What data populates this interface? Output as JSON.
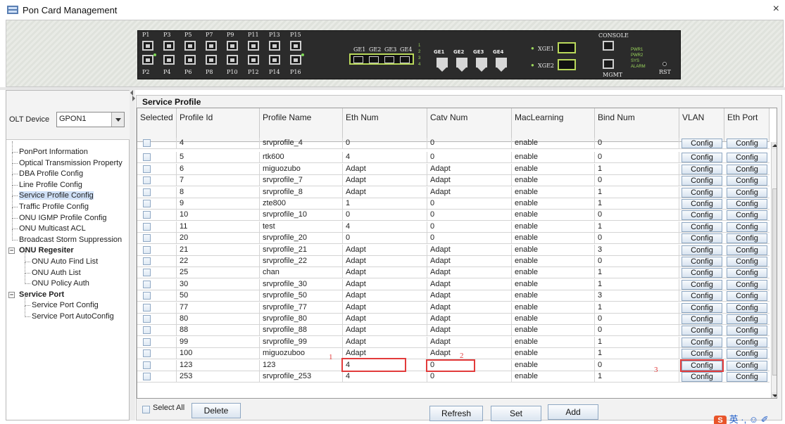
{
  "window": {
    "title": "Pon Card Management",
    "close_glyph": "×"
  },
  "device_panel": {
    "pon_ports_top": [
      "P1",
      "P3",
      "P5",
      "P7",
      "P9",
      "P11",
      "P13",
      "P15"
    ],
    "pon_ports_bottom": [
      "P2",
      "P4",
      "P6",
      "P8",
      "P10",
      "P12",
      "P14",
      "P16"
    ],
    "ge_labels": [
      "GE1",
      "GE2",
      "GE3",
      "GE4"
    ],
    "ge_leds": [
      "1",
      "2",
      "3",
      "4"
    ],
    "ge_opt_labels": [
      "GE1",
      "GE2",
      "GE3",
      "GE4"
    ],
    "xge_labels": [
      "XGE1",
      "XGE2"
    ],
    "console_label": "CONSOLE",
    "mgmt_label": "MGMT",
    "status_leds": [
      "PWR1",
      "PWR2",
      "SYS",
      "ALARM"
    ],
    "rst_label": "RST"
  },
  "left_panel": {
    "olt_label": "OLT Device",
    "olt_value": "GPON1",
    "tree": [
      {
        "label": "PonPort Information",
        "level": 1
      },
      {
        "label": "Optical Transmission Property",
        "level": 1
      },
      {
        "label": "DBA Profile Config",
        "level": 1
      },
      {
        "label": "Line Profile Config",
        "level": 1
      },
      {
        "label": "Service Profile Config",
        "level": 1,
        "selected": true
      },
      {
        "label": "Traffic Profile Config",
        "level": 1
      },
      {
        "label": "ONU IGMP Profile Config",
        "level": 1
      },
      {
        "label": "ONU Multicast ACL",
        "level": 1
      },
      {
        "label": "Broadcast Storm Suppression",
        "level": 1
      },
      {
        "label": "ONU Regesiter",
        "level": 0,
        "group": true
      },
      {
        "label": "ONU Auto Find List",
        "level": 2
      },
      {
        "label": "ONU Auth List",
        "level": 2
      },
      {
        "label": "ONU Policy Auth",
        "level": 2
      },
      {
        "label": "Service Port",
        "level": 0,
        "group": true
      },
      {
        "label": "Service Port Config",
        "level": 2
      },
      {
        "label": "Service Port AutoConfig",
        "level": 2
      }
    ]
  },
  "service_profile": {
    "section_title": "Service Profile",
    "columns": [
      "Selected",
      "Profile Id",
      "Profile Name",
      "Eth Num",
      "Catv Num",
      "MacLearning",
      "Bind Num",
      "VLAN",
      "Eth Port"
    ],
    "config_label": "Config",
    "rows": [
      {
        "id": "4",
        "name": "srvprofile_4",
        "eth": "0",
        "catv": "0",
        "mac": "enable",
        "bind": "0",
        "partial": true
      },
      {
        "id": "5",
        "name": "rtk600",
        "eth": "4",
        "catv": "0",
        "mac": "enable",
        "bind": "0"
      },
      {
        "id": "6",
        "name": "miguozubo",
        "eth": "Adapt",
        "catv": "Adapt",
        "mac": "enable",
        "bind": "1"
      },
      {
        "id": "7",
        "name": "srvprofile_7",
        "eth": "Adapt",
        "catv": "Adapt",
        "mac": "enable",
        "bind": "0"
      },
      {
        "id": "8",
        "name": "srvprofile_8",
        "eth": "Adapt",
        "catv": "Adapt",
        "mac": "enable",
        "bind": "1"
      },
      {
        "id": "9",
        "name": "zte800",
        "eth": "1",
        "catv": "0",
        "mac": "enable",
        "bind": "1"
      },
      {
        "id": "10",
        "name": "srvprofile_10",
        "eth": "0",
        "catv": "0",
        "mac": "enable",
        "bind": "0"
      },
      {
        "id": "11",
        "name": "test",
        "eth": "4",
        "catv": "0",
        "mac": "enable",
        "bind": "1"
      },
      {
        "id": "20",
        "name": "srvprofile_20",
        "eth": "0",
        "catv": "0",
        "mac": "enable",
        "bind": "0"
      },
      {
        "id": "21",
        "name": "srvprofile_21",
        "eth": "Adapt",
        "catv": "Adapt",
        "mac": "enable",
        "bind": "3"
      },
      {
        "id": "22",
        "name": "srvprofile_22",
        "eth": "Adapt",
        "catv": "Adapt",
        "mac": "enable",
        "bind": "0"
      },
      {
        "id": "25",
        "name": "chan",
        "eth": "Adapt",
        "catv": "Adapt",
        "mac": "enable",
        "bind": "1"
      },
      {
        "id": "30",
        "name": "srvprofile_30",
        "eth": "Adapt",
        "catv": "Adapt",
        "mac": "enable",
        "bind": "1"
      },
      {
        "id": "50",
        "name": "srvprofile_50",
        "eth": "Adapt",
        "catv": "Adapt",
        "mac": "enable",
        "bind": "3"
      },
      {
        "id": "77",
        "name": "srvprofile_77",
        "eth": "Adapt",
        "catv": "Adapt",
        "mac": "enable",
        "bind": "1"
      },
      {
        "id": "80",
        "name": "srvprofile_80",
        "eth": "Adapt",
        "catv": "Adapt",
        "mac": "enable",
        "bind": "0"
      },
      {
        "id": "88",
        "name": "srvprofile_88",
        "eth": "Adapt",
        "catv": "Adapt",
        "mac": "enable",
        "bind": "0"
      },
      {
        "id": "99",
        "name": "srvprofile_99",
        "eth": "Adapt",
        "catv": "Adapt",
        "mac": "enable",
        "bind": "1"
      },
      {
        "id": "100",
        "name": "miguozuboo",
        "eth": "Adapt",
        "catv": "Adapt",
        "mac": "enable",
        "bind": "1"
      },
      {
        "id": "123",
        "name": "123",
        "eth": "4",
        "catv": "0",
        "mac": "enable",
        "bind": "0",
        "editing": true
      },
      {
        "id": "253",
        "name": "srvprofile_253",
        "eth": "4",
        "catv": "0",
        "mac": "enable",
        "bind": "1"
      }
    ],
    "annotations": [
      "1",
      "2",
      "3"
    ],
    "annotation_color": "#e23b3b"
  },
  "footer": {
    "select_all_label": "Select All",
    "delete_label": "Delete",
    "refresh_label": "Refresh",
    "set_label": "Set",
    "add_label": "Add",
    "ime_logo": "S",
    "ime_text": "英 ·, ☺ ✐"
  }
}
